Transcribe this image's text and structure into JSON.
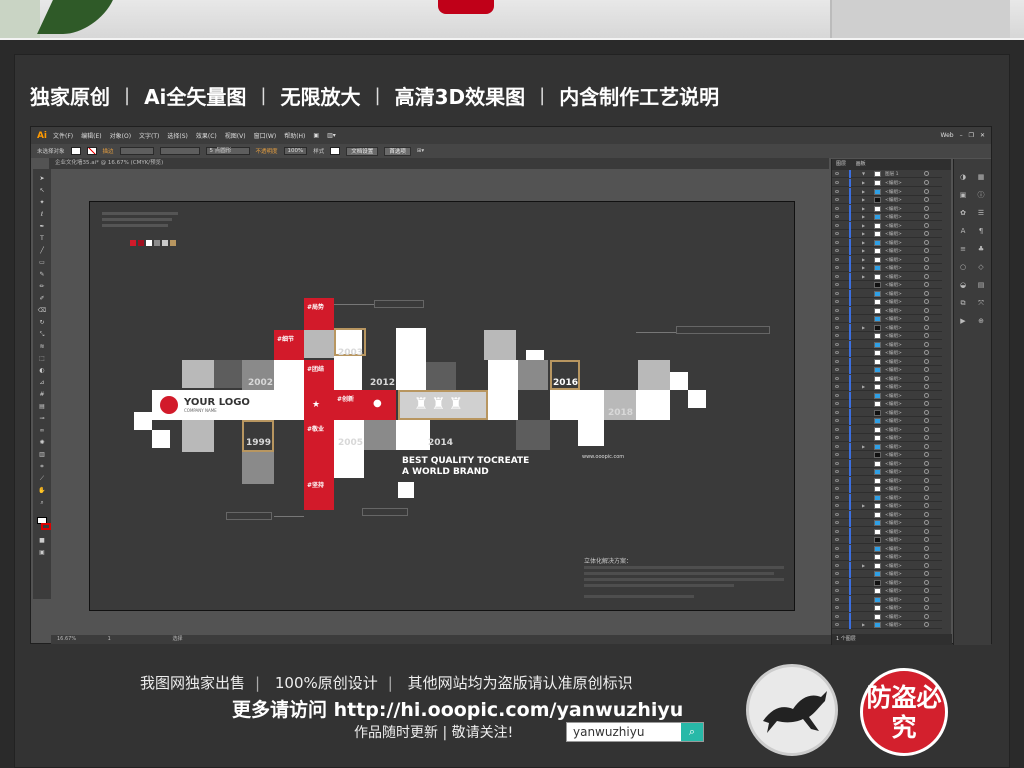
{
  "headline": {
    "items": [
      "独家原创",
      "Ai全矢量图",
      "无限放大",
      "高清3D效果图",
      "内含制作工艺说明"
    ],
    "separator": "|"
  },
  "illustrator": {
    "logo": "Ai",
    "menu": [
      "文件(F)",
      "编辑(E)",
      "对象(O)",
      "文字(T)",
      "选择(S)",
      "效果(C)",
      "视图(V)",
      "窗口(W)",
      "帮助(H)"
    ],
    "workspace": "Web",
    "control": {
      "selection": "未选择对象",
      "stroke_label": "描边",
      "stroke_style": "5 点圆形",
      "opacity_label": "不透明度",
      "opacity_value": "100%",
      "style_label": "样式",
      "doc_setup": "文档设置",
      "prefs": "首选项"
    },
    "doc_tab": "企业文化墙35.ai* @ 16.67% (CMYK/预览)",
    "status": {
      "zoom": "16.67%",
      "page": "1",
      "tool": "选择"
    },
    "panel_tabs": [
      "图层",
      "画板"
    ],
    "layer_top": "图层 1",
    "layer_item": "<编组>",
    "layer_footer": "1 个图层"
  },
  "design": {
    "logo": "YOUR LOGO",
    "company": "COMPANY NAME",
    "tags": [
      "#局势",
      "#细节",
      "#团结",
      "#创新",
      "#敬业",
      "#坚持"
    ],
    "years": [
      "2002",
      "2003",
      "2012",
      "2016",
      "2018",
      "1999",
      "2005",
      "2014"
    ],
    "slogan1": "BEST QUALITY TOCREATE",
    "slogan2": "A WORLD BRAND",
    "url": "www.ooopic.com",
    "section_title": "立体化解决方案：",
    "colors": {
      "red": "#d21a2a",
      "gold": "#b89660"
    }
  },
  "footer": {
    "line1": [
      "我图网独家出售",
      "100%原创设计",
      "其他网站均为盗版请认准原创标识"
    ],
    "line2": "更多请访问 http://hi.ooopic.com/yanwuzhiyu",
    "line3": "作品随时更新 | 敬请关注!",
    "search_value": "yanwuzhiyu",
    "seal_text": "防盗必究"
  }
}
